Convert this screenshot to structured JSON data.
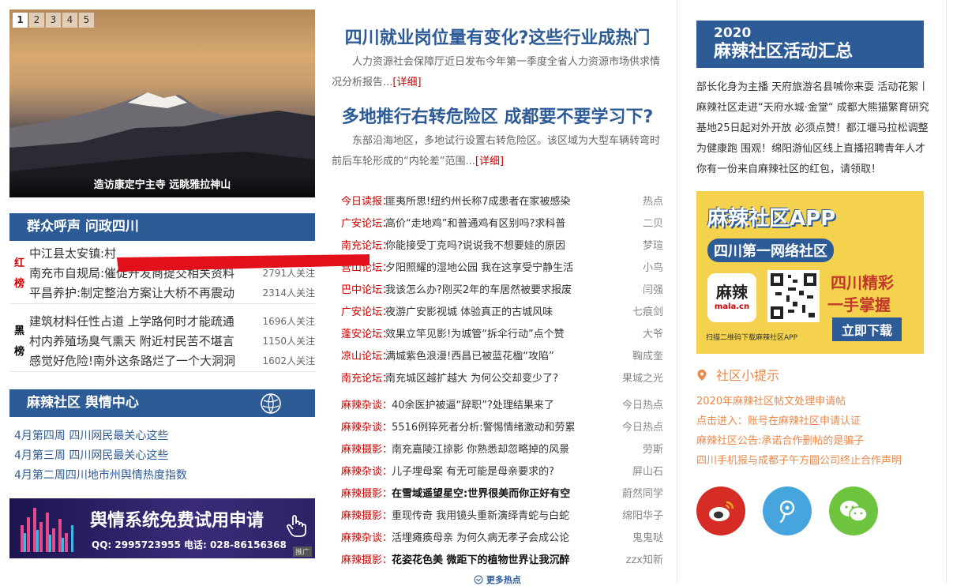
{
  "slider": {
    "pages": [
      "1",
      "2",
      "3",
      "4",
      "5"
    ],
    "caption": "造访康定宁主寺 远眺雅拉神山"
  },
  "voice": {
    "title": "群众呼声 问政四川",
    "red_label": [
      "红",
      "榜"
    ],
    "red": [
      {
        "t": "中江县太安镇:村",
        "n": ""
      },
      {
        "t": "南充市自规局:催促开发商提交相关资料",
        "n": "2791人关注"
      },
      {
        "t": "平昌养护:制定整治方案让大桥不再震动",
        "n": "2314人关注"
      }
    ],
    "black_label": [
      "黑",
      "榜"
    ],
    "black": [
      {
        "t": "建筑材料任性占道 上学路何时才能疏通",
        "n": "1696人关注"
      },
      {
        "t": "村内养殖场臭气熏天 附近村民苦不堪言",
        "n": "1150人关注"
      },
      {
        "t": "感觉好危险!南外这条路烂了一个大洞洞",
        "n": "1602人关注"
      }
    ]
  },
  "opinion": {
    "title": "麻辣社区 舆情中心",
    "links": [
      "4月第四周 四川网民最关心这些",
      "4月第三周 四川网民最关心这些",
      "4月第二周四川地市州舆情热度指数"
    ]
  },
  "banner": {
    "big": "舆情系统免费试用申请",
    "small": "QQ: 2995723955  电话: 028-86156368",
    "ad": "推广"
  },
  "headlines": [
    {
      "title": "四川就业岗位量有变化?这些行业成热门",
      "summary": "人力资源社会保障厅近日发布今年第一季度全省人力资源市场供求情况分析报告...",
      "more": "[详细]"
    },
    {
      "title": "多地推行右转危险区 成都要不要学习下?",
      "summary": "东部沿海地区，多地试行设置右转危险区。该区域为大型车辆转弯时前后车轮形成的“内轮差”范围...",
      "more": "[详细]"
    }
  ],
  "forum": [
    {
      "tag": "今日读报：",
      "t": "匪夷所思!纽约州长称7成患者在家被感染",
      "a": "热点"
    },
    {
      "tag": "广安论坛：",
      "t": "高价“走地鸡”和普通鸡有区别吗?求科普",
      "a": "二贝"
    },
    {
      "tag": "南充论坛：",
      "t": "你能接受丁克吗?说说我不想要娃的原因",
      "a": "梦瑄"
    },
    {
      "tag": "营山论坛：",
      "t": "夕阳照耀的湿地公园 我在这享受宁静生活",
      "a": "小鸟"
    },
    {
      "tag": "巴中论坛：",
      "t": "我该怎么办?刚买2年的车居然被要求报废",
      "a": "闫强"
    },
    {
      "tag": "广安论坛：",
      "t": "夜游广安影视城 体验真正的古城风味",
      "a": "七痕剑"
    },
    {
      "tag": "蓬安论坛：",
      "t": "效果立竿见影!为城管“拆伞行动”点个赞",
      "a": "大爷"
    },
    {
      "tag": "凉山论坛：",
      "t": "满城紫色浪漫!西昌已被蓝花楹“攻陷”",
      "a": "鞠成奎"
    },
    {
      "tag": "南充论坛：",
      "t": "南充城区越扩越大 为何公交却变少了?",
      "a": "果城之光"
    }
  ],
  "mala": [
    {
      "tag": "麻辣杂谈：",
      "t": "40余医护被逼“辞职”?处理结果来了",
      "a": "今日热点",
      "b": false
    },
    {
      "tag": "麻辣杂谈：",
      "t": "5516例猝死者分析:警惕情绪激动和劳累",
      "a": "今日热点",
      "b": false
    },
    {
      "tag": "麻辣摄影：",
      "t": "南充嘉陵江掠影 你熟悉却忽略掉的风景",
      "a": "劳斯",
      "b": false
    },
    {
      "tag": "麻辣杂谈：",
      "t": "儿子埋母案 有无可能是母亲要求的?",
      "a": "屏山石",
      "b": false
    },
    {
      "tag": "麻辣摄影：",
      "t": "在雪域遥望星空:世界很美而你正好有空",
      "a": "蔚然同学",
      "b": true
    },
    {
      "tag": "麻辣摄影：",
      "t": "重现传奇 我用镜头重新演绎青蛇与白蛇",
      "a": "绵阳华子",
      "b": false
    },
    {
      "tag": "麻辣杂谈：",
      "t": "活埋瘫痪母亲 为何久病无孝子会成公论",
      "a": "鬼鬼哒",
      "b": false
    },
    {
      "tag": "麻辣摄影：",
      "t": "花姿花色美 微距下的植物世界让我沉醉",
      "a": "zzx知新",
      "b": true
    }
  ],
  "more_hot": "更多热点",
  "activity": {
    "year": "2020",
    "title": "麻辣社区活动汇总",
    "text": "部长化身为主播 天府旅游名县喊你来耍 活动花絮丨麻辣社区走进“天府水城·金堂“ 成都大熊猫繁育研究基地25日起对外开放 必须点赞！都江堰马拉松调整为健康跑 围观！绵阳游仙区线上直播招聘青年人才 你有一份来自麻辣社区的红包，请领取！"
  },
  "app": {
    "title": "麻辣社区APP",
    "sub": "四川第一网络社区",
    "logo": "麻辣",
    "logo_sub": "mala.cn",
    "slogan1": "四川精彩",
    "slogan2": "一手掌握",
    "download": "立即下载",
    "scan": "扫描二维码下载麻辣社区APP"
  },
  "tips": {
    "title": "社区小提示",
    "items": [
      "2020年麻辣社区帖文处理申请帖",
      "点击进入：账号在麻辣社区申请认证",
      "麻辣社区公告:承诺合作删帖的是骗子",
      "四川手机报与成都子午方圆公司终止合作声明"
    ]
  },
  "colors": {
    "accent": "#2d5b96",
    "red": "#cc0000",
    "tip": "#e8894a",
    "weibo": "#d52d26",
    "qzone": "#45a5dc",
    "wechat": "#6ec43e"
  }
}
